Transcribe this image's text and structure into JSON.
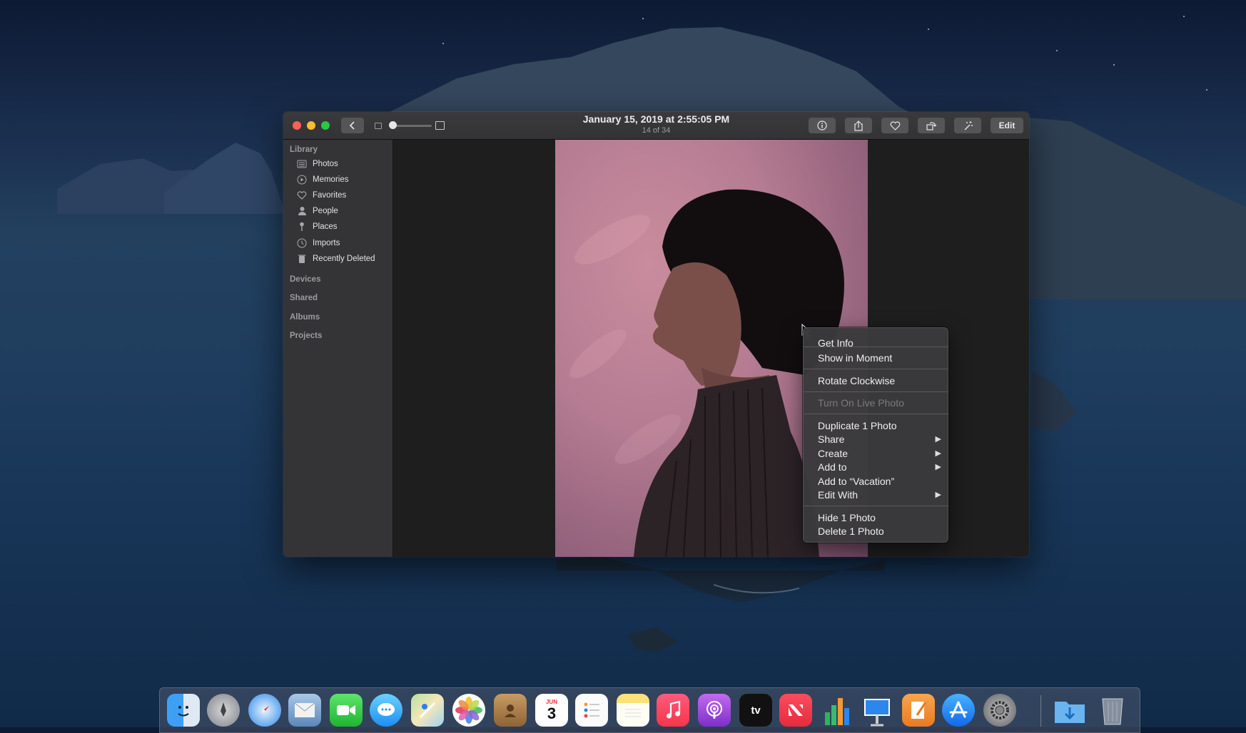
{
  "window": {
    "title_date": "January 15, 2019 at 2:55:05 PM",
    "title_count": "14 of 34",
    "toolbar": {
      "edit_label": "Edit",
      "back_icon": "chevron-left-icon",
      "info_icon": "info-icon",
      "share_icon": "share-icon",
      "favorite_icon": "heart-icon",
      "rotate_icon": "rotate-icon",
      "enhance_icon": "magic-wand-icon"
    }
  },
  "sidebar": {
    "library_header": "Library",
    "items": [
      {
        "label": "Photos",
        "icon": "photos-icon"
      },
      {
        "label": "Memories",
        "icon": "memories-icon"
      },
      {
        "label": "Favorites",
        "icon": "heart-icon"
      },
      {
        "label": "People",
        "icon": "person-icon"
      },
      {
        "label": "Places",
        "icon": "pin-icon"
      },
      {
        "label": "Imports",
        "icon": "clock-icon"
      },
      {
        "label": "Recently Deleted",
        "icon": "trash-icon"
      }
    ],
    "sections": [
      "Devices",
      "Shared",
      "Albums",
      "Projects"
    ]
  },
  "context_menu": {
    "items": [
      {
        "label": "Get Info",
        "enabled": true
      },
      {
        "label": "Show in Moment",
        "enabled": true
      },
      {
        "label": "Rotate Clockwise",
        "enabled": true
      },
      {
        "label": "Turn On Live Photo",
        "enabled": false
      },
      {
        "label": "Duplicate 1 Photo",
        "enabled": true
      },
      {
        "label": "Share",
        "enabled": true,
        "submenu": true
      },
      {
        "label": "Create",
        "enabled": true,
        "submenu": true
      },
      {
        "label": "Add to",
        "enabled": true,
        "submenu": true
      },
      {
        "label": "Add to “Vacation”",
        "enabled": true
      },
      {
        "label": "Edit With",
        "enabled": true,
        "submenu": true
      },
      {
        "label": "Hide 1 Photo",
        "enabled": true
      },
      {
        "label": "Delete 1 Photo",
        "enabled": true
      }
    ]
  },
  "dock": {
    "apps": [
      "finder-icon",
      "launchpad-icon",
      "safari-icon",
      "mail-icon",
      "facetime-icon",
      "messages-icon",
      "maps-icon",
      "photos-icon",
      "contacts-icon",
      "calendar-icon",
      "reminders-icon",
      "notes-icon",
      "music-icon",
      "podcasts-icon",
      "tv-icon",
      "news-icon",
      "numbers-icon",
      "keynote-icon",
      "pages-icon",
      "app-store-icon",
      "system-preferences-icon",
      "downloads-folder-icon",
      "trash-icon"
    ],
    "calendar_month": "JUN",
    "calendar_day": "3",
    "tv_label": "tv"
  }
}
